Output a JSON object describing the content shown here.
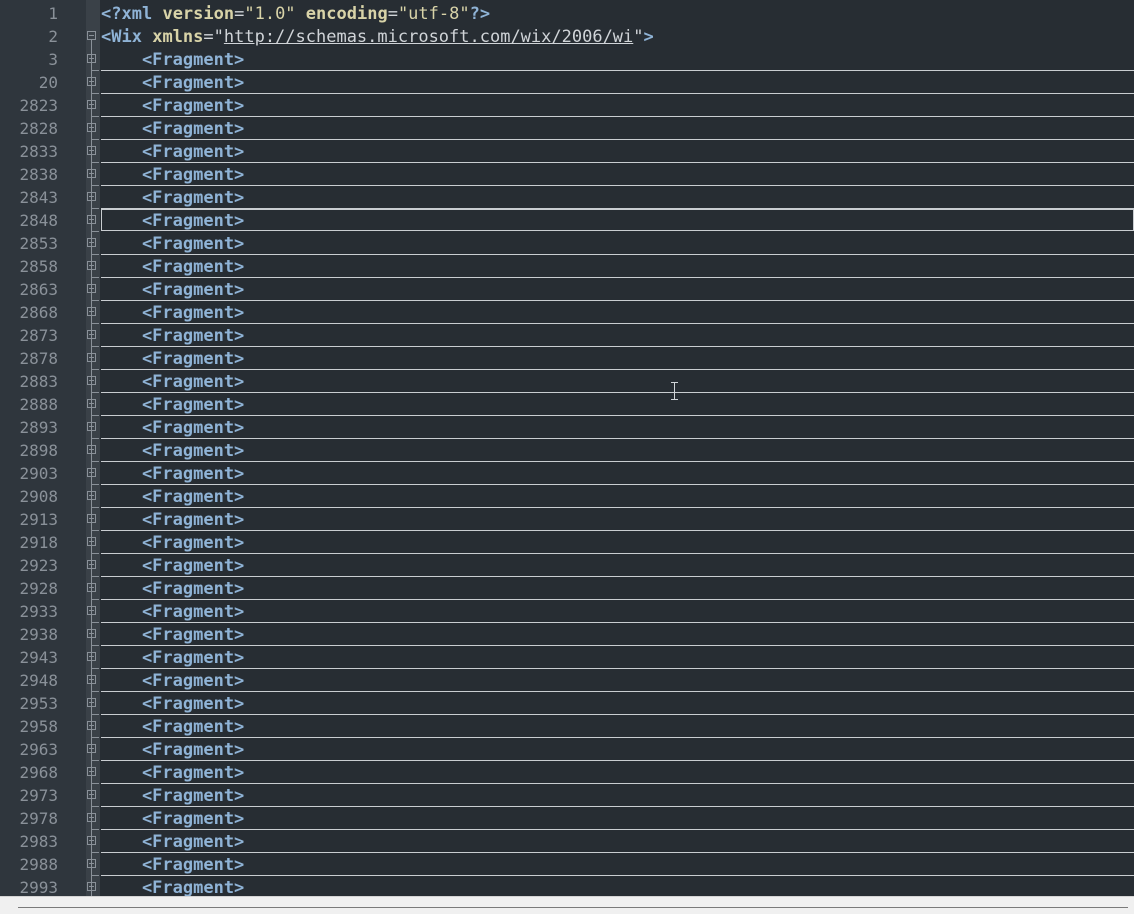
{
  "editor": {
    "lines": [
      {
        "num": "1",
        "kind": "decl",
        "parts": [
          {
            "t": "<?",
            "c": "tag"
          },
          {
            "t": "xml",
            "c": "tag"
          },
          {
            "t": " ",
            "c": "punct"
          },
          {
            "t": "version",
            "c": "attr"
          },
          {
            "t": "=",
            "c": "punct"
          },
          {
            "t": "\"1.0\"",
            "c": "str"
          },
          {
            "t": " ",
            "c": "punct"
          },
          {
            "t": "encoding",
            "c": "attr"
          },
          {
            "t": "=",
            "c": "punct"
          },
          {
            "t": "\"utf-8\"",
            "c": "str"
          },
          {
            "t": "?>",
            "c": "tag"
          }
        ]
      },
      {
        "num": "2",
        "kind": "root",
        "parts": [
          {
            "t": "<Wix",
            "c": "tag"
          },
          {
            "t": " ",
            "c": "punct"
          },
          {
            "t": "xmlns",
            "c": "attr"
          },
          {
            "t": "=\"",
            "c": "punct"
          },
          {
            "t": "http://schemas.microsoft.com/wix/2006/wi",
            "c": "url"
          },
          {
            "t": "\"",
            "c": "punct"
          },
          {
            "t": ">",
            "c": "tag"
          }
        ]
      },
      {
        "num": "3",
        "kind": "fragment",
        "text": "    <Fragment>"
      },
      {
        "num": "20",
        "kind": "fragment",
        "text": "    <Fragment>"
      },
      {
        "num": "2823",
        "kind": "fragment",
        "text": "    <Fragment>"
      },
      {
        "num": "2828",
        "kind": "fragment",
        "text": "    <Fragment>"
      },
      {
        "num": "2833",
        "kind": "fragment",
        "text": "    <Fragment>"
      },
      {
        "num": "2838",
        "kind": "fragment",
        "text": "    <Fragment>"
      },
      {
        "num": "2843",
        "kind": "fragment",
        "text": "    <Fragment>"
      },
      {
        "num": "2848",
        "kind": "fragment",
        "text": "    <Fragment>",
        "current": true
      },
      {
        "num": "2853",
        "kind": "fragment",
        "text": "    <Fragment>"
      },
      {
        "num": "2858",
        "kind": "fragment",
        "text": "    <Fragment>"
      },
      {
        "num": "2863",
        "kind": "fragment",
        "text": "    <Fragment>"
      },
      {
        "num": "2868",
        "kind": "fragment",
        "text": "    <Fragment>"
      },
      {
        "num": "2873",
        "kind": "fragment",
        "text": "    <Fragment>"
      },
      {
        "num": "2878",
        "kind": "fragment",
        "text": "    <Fragment>"
      },
      {
        "num": "2883",
        "kind": "fragment",
        "text": "    <Fragment>"
      },
      {
        "num": "2888",
        "kind": "fragment",
        "text": "    <Fragment>"
      },
      {
        "num": "2893",
        "kind": "fragment",
        "text": "    <Fragment>"
      },
      {
        "num": "2898",
        "kind": "fragment",
        "text": "    <Fragment>"
      },
      {
        "num": "2903",
        "kind": "fragment",
        "text": "    <Fragment>"
      },
      {
        "num": "2908",
        "kind": "fragment",
        "text": "    <Fragment>"
      },
      {
        "num": "2913",
        "kind": "fragment",
        "text": "    <Fragment>"
      },
      {
        "num": "2918",
        "kind": "fragment",
        "text": "    <Fragment>"
      },
      {
        "num": "2923",
        "kind": "fragment",
        "text": "    <Fragment>"
      },
      {
        "num": "2928",
        "kind": "fragment",
        "text": "    <Fragment>"
      },
      {
        "num": "2933",
        "kind": "fragment",
        "text": "    <Fragment>"
      },
      {
        "num": "2938",
        "kind": "fragment",
        "text": "    <Fragment>"
      },
      {
        "num": "2943",
        "kind": "fragment",
        "text": "    <Fragment>"
      },
      {
        "num": "2948",
        "kind": "fragment",
        "text": "    <Fragment>"
      },
      {
        "num": "2953",
        "kind": "fragment",
        "text": "    <Fragment>"
      },
      {
        "num": "2958",
        "kind": "fragment",
        "text": "    <Fragment>"
      },
      {
        "num": "2963",
        "kind": "fragment",
        "text": "    <Fragment>"
      },
      {
        "num": "2968",
        "kind": "fragment",
        "text": "    <Fragment>"
      },
      {
        "num": "2973",
        "kind": "fragment",
        "text": "    <Fragment>"
      },
      {
        "num": "2978",
        "kind": "fragment",
        "text": "    <Fragment>"
      },
      {
        "num": "2983",
        "kind": "fragment",
        "text": "    <Fragment>"
      },
      {
        "num": "2988",
        "kind": "fragment",
        "text": "    <Fragment>"
      },
      {
        "num": "2993",
        "kind": "fragment",
        "text": "    <Fragment>"
      }
    ]
  },
  "colors": {
    "background": "#272d33",
    "gutter": "#2f363d",
    "line_number": "#8a9199",
    "tag": "#8fb3d6",
    "attribute": "#d8d3a8"
  },
  "icons": {
    "fold_marker": "fold-plus-icon",
    "cursor": "text-cursor-icon"
  }
}
